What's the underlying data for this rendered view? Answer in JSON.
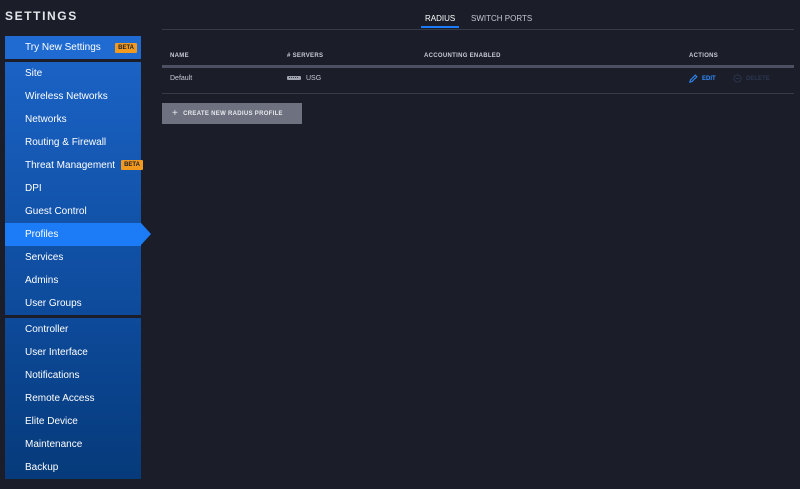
{
  "settings_title": "SETTINGS",
  "sidebar": {
    "try_new": {
      "label": "Try New Settings",
      "badge": "BETA"
    },
    "site_items": [
      {
        "label": "Site"
      },
      {
        "label": "Wireless Networks"
      },
      {
        "label": "Networks"
      },
      {
        "label": "Routing & Firewall"
      },
      {
        "label": "Threat Management",
        "badge": "BETA"
      },
      {
        "label": "DPI"
      },
      {
        "label": "Guest Control"
      },
      {
        "label": "Profiles",
        "active": true
      },
      {
        "label": "Services"
      },
      {
        "label": "Admins"
      },
      {
        "label": "User Groups"
      }
    ],
    "controller_items": [
      {
        "label": "Controller"
      },
      {
        "label": "User Interface"
      },
      {
        "label": "Notifications"
      },
      {
        "label": "Remote Access"
      },
      {
        "label": "Elite Device"
      },
      {
        "label": "Maintenance"
      },
      {
        "label": "Backup"
      }
    ]
  },
  "tabs": [
    {
      "label": "RADIUS",
      "active": true
    },
    {
      "label": "SWITCH PORTS",
      "active": false
    }
  ],
  "table": {
    "headers": {
      "name": "NAME",
      "servers": "# SERVERS",
      "accounting": "ACCOUNTING ENABLED",
      "actions": "ACTIONS"
    },
    "rows": [
      {
        "name": "Default",
        "servers": "USG",
        "accounting": "",
        "edit": "EDIT",
        "delete": "DELETE"
      }
    ]
  },
  "create_button": {
    "label": "CREATE NEW RADIUS PROFILE",
    "icon": "plus-icon"
  },
  "colors": {
    "accent": "#1c7cf8",
    "beta": "#f29920",
    "background": "#1b1e29"
  }
}
